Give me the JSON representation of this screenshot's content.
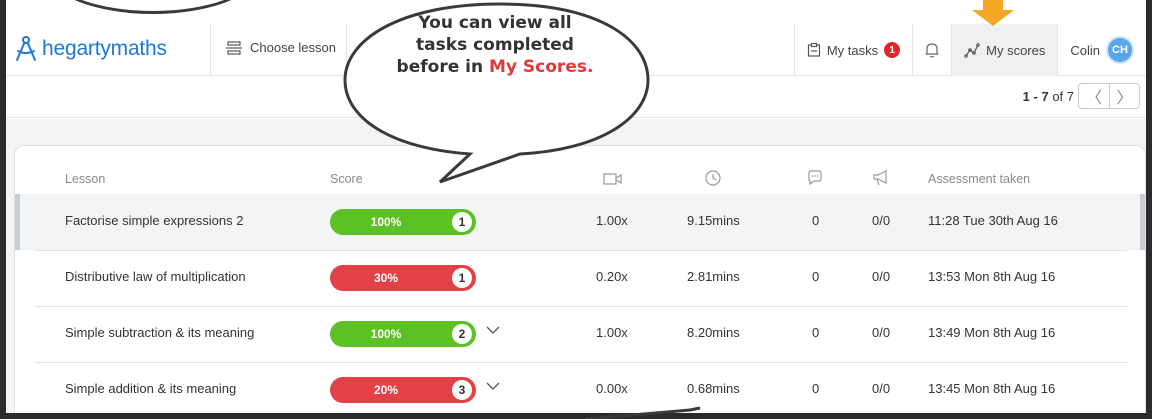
{
  "header": {
    "logo_text": "hegartymaths",
    "choose_lesson": "Choose lesson",
    "my_tasks": "My tasks",
    "my_tasks_count": "1",
    "my_scores": "My scores",
    "user_name": "Colin",
    "avatar_initials": "CH"
  },
  "pager": {
    "range": "1 - 7",
    "of": "of 7",
    "prev": "〈",
    "next": "〉"
  },
  "callout": {
    "line1": "You can view all tasks completed before in ",
    "highlight": "My Scores",
    "tail": "."
  },
  "table": {
    "columns": {
      "lesson": "Lesson",
      "score": "Score",
      "assessment": "Assessment taken"
    },
    "rows": [
      {
        "lesson": "Factorise simple expressions 2",
        "score": "100%",
        "score_color": "#5cc124",
        "attempt": "1",
        "expand": false,
        "speed": "1.00x",
        "time": "9.15mins",
        "comments": "0",
        "announce": "0/0",
        "taken": "11:28 Tue 30th Aug 16"
      },
      {
        "lesson": "Distributive law of multiplication",
        "score": "30%",
        "score_color": "#e24148",
        "attempt": "1",
        "expand": false,
        "speed": "0.20x",
        "time": "2.81mins",
        "comments": "0",
        "announce": "0/0",
        "taken": "13:53 Mon 8th Aug 16"
      },
      {
        "lesson": "Simple subtraction & its meaning",
        "score": "100%",
        "score_color": "#5cc124",
        "attempt": "2",
        "expand": true,
        "speed": "1.00x",
        "time": "8.20mins",
        "comments": "0",
        "announce": "0/0",
        "taken": "13:49 Mon 8th Aug 16"
      },
      {
        "lesson": "Simple addition & its meaning",
        "score": "20%",
        "score_color": "#e24148",
        "attempt": "3",
        "expand": true,
        "speed": "0.00x",
        "time": "0.68mins",
        "comments": "0",
        "announce": "0/0",
        "taken": "13:45 Mon 8th Aug 16"
      }
    ]
  },
  "colors": {
    "brand_blue": "#1f77d3",
    "success_green": "#5cc124",
    "fail_red": "#e24148",
    "badge_red": "#e0262b",
    "arrow_orange": "#f5a623"
  }
}
